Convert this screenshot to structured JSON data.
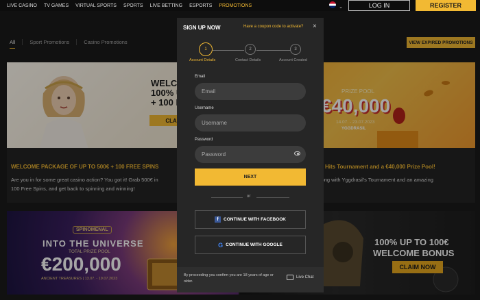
{
  "nav": {
    "items": [
      "LIVE CASINO",
      "TV GAMES",
      "VIRTUAL SPORTS",
      "SPORTS",
      "LIVE BETTING",
      "ESPORTS",
      "PROMOTIONS"
    ],
    "active_index": 6,
    "login_label": "LOG IN",
    "register_label": "REGISTER",
    "language_icon": "uk-flag-icon"
  },
  "filters": {
    "items": [
      "All",
      "Sport Promotions",
      "Casino Promotions"
    ],
    "active": "All",
    "expired_button": "VIEW EXPIRED PROMOTIONS"
  },
  "promos": {
    "welcome": {
      "banner_text": "WELCOME P\n100% UP T\n+ 100 FRE",
      "banner_claim": "CLAIM N",
      "title": "WELCOME PACKAGE OF UP TO 500€ + 100 FREE SPINS",
      "body": "Are you in for some great casino action? You got it! Grab 500€ in\n100 Free Spins, and get back to spinning and winning!"
    },
    "tournament": {
      "prize_label": "PRIZE POOL",
      "amount": "€40,000",
      "dates": "14.07. - 23.07.2023",
      "brand": "YGGDRASIL",
      "title": "Hits Tournament and a €40,000 Prize Pool!",
      "body": "g strong with Yggdrasil's Tournament and an amazing"
    },
    "universe": {
      "logo": "SPINOMENAL",
      "heading": "INTO THE UNIVERSE",
      "prize_label": "TOTAL PRIZE POOL",
      "amount": "€200,000",
      "footer": "ANCIENT TREASURES | 13.07. - 19.07.2023"
    },
    "bonus": {
      "line1": "100% UP TO 100€",
      "line2": "WELCOME BONUS",
      "claim": "CLAIM NOW"
    }
  },
  "modal": {
    "title": "SIGN UP NOW",
    "coupon_link": "Have a coupon code to activate?",
    "close": "×",
    "steps": [
      {
        "num": "1",
        "label": "Account Details"
      },
      {
        "num": "2",
        "label": "Contact Details"
      },
      {
        "num": "3",
        "label": "Account Created"
      }
    ],
    "active_step": 1,
    "email_label": "Email",
    "email_placeholder": "Email",
    "username_label": "Username",
    "username_placeholder": "Username",
    "password_label": "Password",
    "password_placeholder": "Password",
    "next_label": "NEXT",
    "or_label": "or",
    "facebook_label": "CONTINUE WITH FACEBOOK",
    "google_label": "CONTINUE WITH GOOGLE",
    "disclaimer": "By proceeding you confirm you are 18 years of age or older.",
    "live_chat": "Live Chat"
  },
  "colors": {
    "accent": "#f2b933",
    "background": "#1b1b1b",
    "modal": "#262626"
  }
}
